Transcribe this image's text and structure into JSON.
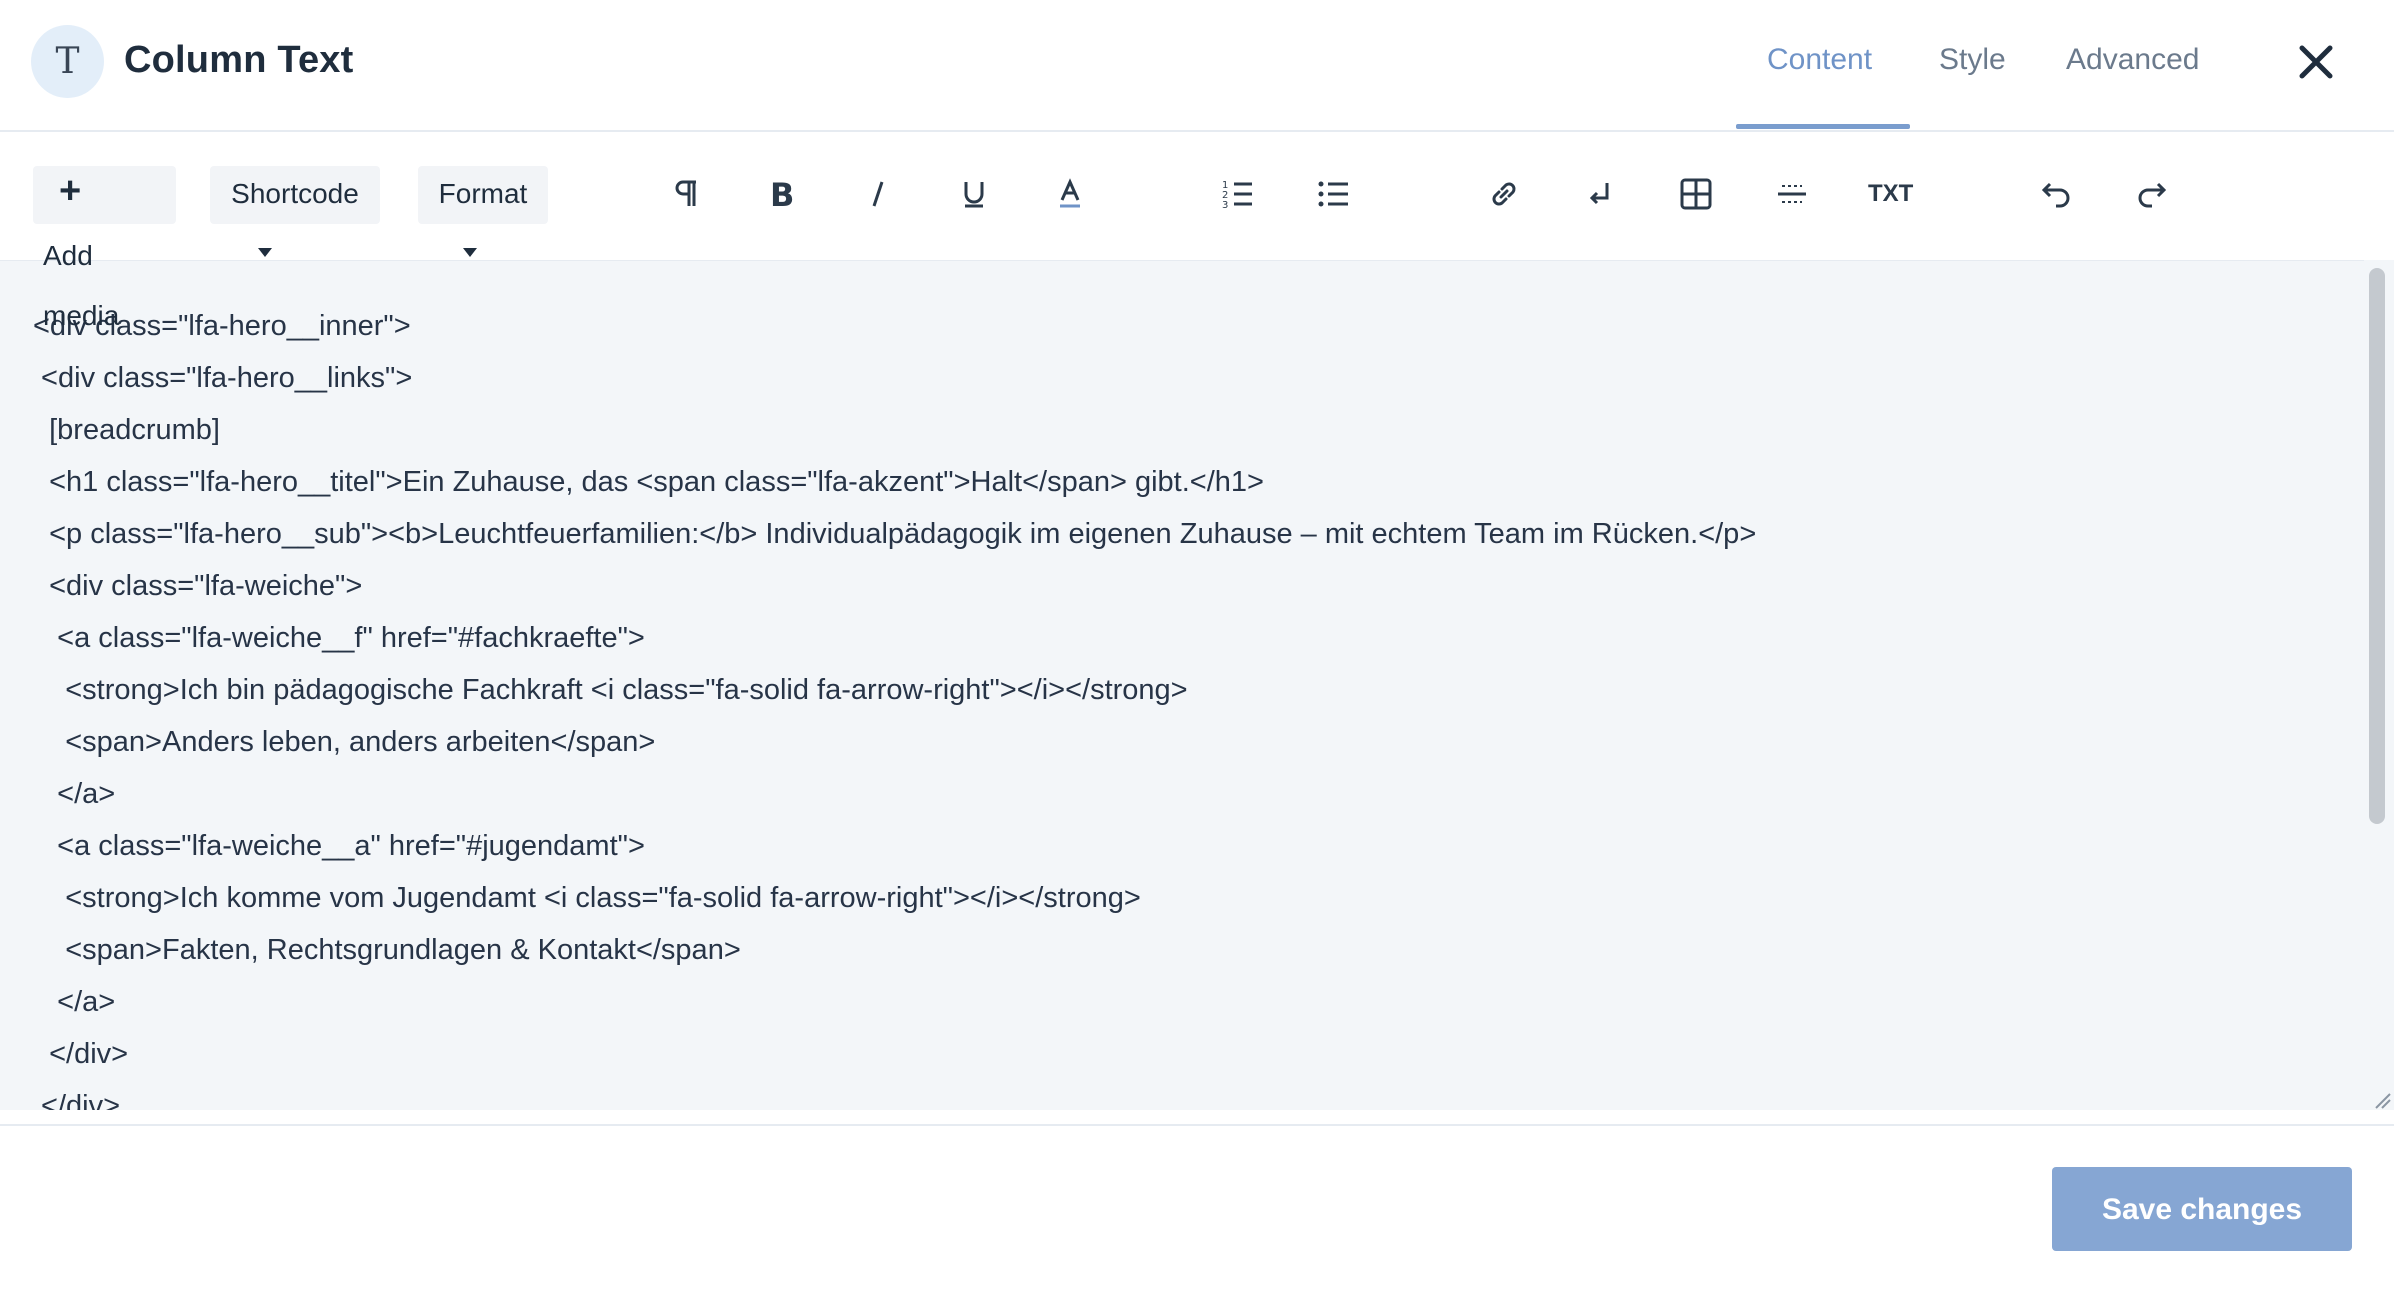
{
  "header": {
    "avatar_letter": "T",
    "title": "Column Text",
    "tabs": [
      {
        "label": "Content",
        "active": true
      },
      {
        "label": "Style",
        "active": false
      },
      {
        "label": "Advanced",
        "active": false
      }
    ],
    "close_icon": "close-icon"
  },
  "toolbar": {
    "add_media_plus": "+",
    "add_media_line1": "Add",
    "add_media_line2": "media",
    "shortcode_label": "Shortcode",
    "format_label": "Format",
    "txt_label": "TXT",
    "icons": [
      "paragraph-icon",
      "bold-icon",
      "italic-icon",
      "underline-icon",
      "text-color-icon",
      "ordered-list-icon",
      "bullet-list-icon",
      "link-icon",
      "line-break-icon",
      "table-icon",
      "horizontal-rule-icon",
      "txt-icon",
      "undo-icon",
      "redo-icon"
    ]
  },
  "editor": {
    "lines": [
      "<div class=\"lfa-hero__inner\">",
      " <div class=\"lfa-hero__links\">",
      "  [breadcrumb]",
      "  <h1 class=\"lfa-hero__titel\">Ein Zuhause, das <span class=\"lfa-akzent\">Halt</span> gibt.</h1>",
      "  <p class=\"lfa-hero__sub\"><b>Leuchtfeuerfamilien:</b> Individualpädagogik im eigenen Zuhause – mit echtem Team im Rücken.</p>",
      "  <div class=\"lfa-weiche\">",
      "   <a class=\"lfa-weiche__f\" href=\"#fachkraefte\">",
      "    <strong>Ich bin pädagogische Fachkraft <i class=\"fa-solid fa-arrow-right\"></i></strong>",
      "    <span>Anders leben, anders arbeiten</span>",
      "   </a>",
      "   <a class=\"lfa-weiche__a\" href=\"#jugendamt\">",
      "    <strong>Ich komme vom Jugendamt <i class=\"fa-solid fa-arrow-right\"></i></strong>",
      "    <span>Fakten, Rechtsgrundlagen & Kontakt</span>",
      "   </a>",
      "  </div>",
      " </div>"
    ]
  },
  "footer": {
    "save_label": "Save changes"
  },
  "colors": {
    "accent": "#7a9dce",
    "save_button": "#86a6d3",
    "editor_bg": "#f3f6f9"
  }
}
